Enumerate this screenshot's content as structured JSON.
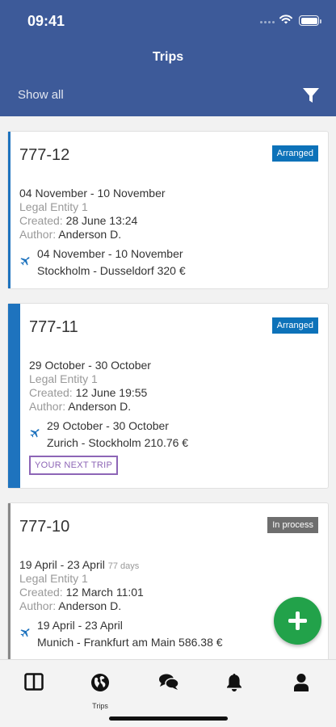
{
  "status_bar": {
    "time": "09:41"
  },
  "header": {
    "title": "Trips",
    "show_all": "Show all"
  },
  "trips": [
    {
      "number": "777-12",
      "status": "Arranged",
      "dates": "04 November - 10 November",
      "entity": "Legal Entity 1",
      "created_label": "Created:",
      "created": "28 June 13:24",
      "author_label": "Author:",
      "author": "Anderson D.",
      "segment_dates": "04 November - 10 November",
      "segment_route": "Stockholm - Dusseldorf 320 €"
    },
    {
      "number": "777-11",
      "status": "Arranged",
      "dates": "29 October - 30 October",
      "entity": "Legal Entity 1",
      "created_label": "Created:",
      "created": "12 June 19:55",
      "author_label": "Author:",
      "author": "Anderson D.",
      "segment_dates": "29 October - 30 October",
      "segment_route": "Zurich - Stockholm 210.76 €",
      "highlight": "YOUR NEXT TRIP"
    },
    {
      "number": "777-10",
      "status": "In process",
      "dates": "19 April - 23 April",
      "days": "77 days",
      "entity": "Legal Entity 1",
      "created_label": "Created:",
      "created": "12 March 11:01",
      "author_label": "Author:",
      "author": "Anderson D.",
      "segment_dates": "19 April - 23 April",
      "segment_route": "Munich - Frankfurt am Main 586.38 €"
    }
  ],
  "bottom_nav": {
    "items": [
      {
        "icon": "dashboard-icon",
        "label": ""
      },
      {
        "icon": "globe-icon",
        "label": "Trips"
      },
      {
        "icon": "chat-icon",
        "label": ""
      },
      {
        "icon": "bell-icon",
        "label": ""
      },
      {
        "icon": "user-icon",
        "label": ""
      }
    ]
  },
  "colors": {
    "header": "#3d5a99",
    "accent_blue": "#1e73be",
    "arranged": "#0d72b9",
    "in_process": "#6e6e6e",
    "next_trip": "#8d65b6",
    "fab": "#22a24a"
  }
}
